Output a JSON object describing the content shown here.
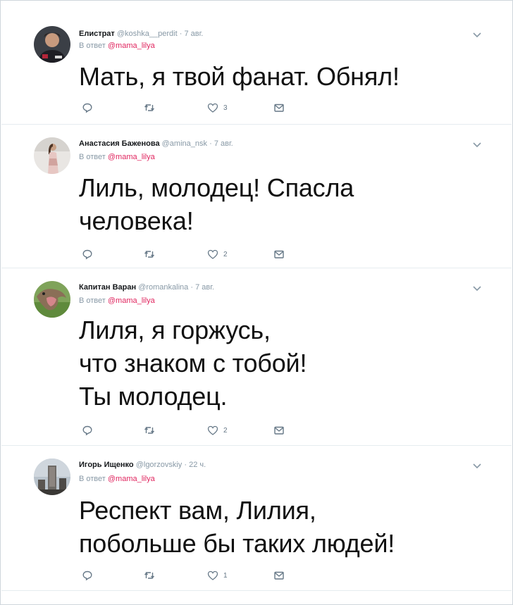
{
  "tweets": [
    {
      "name": "Елистрат",
      "handle": "@koshka__perdit",
      "time": "7 авг.",
      "reply_prefix": "В ответ",
      "reply_to": "@mama_lilya",
      "text": "Мать, я твой фанат. Обнял!",
      "likes": "3"
    },
    {
      "name": "Анастасия Баженова",
      "handle": "@amina_nsk",
      "time": "7 авг.",
      "reply_prefix": "В ответ",
      "reply_to": "@mama_lilya",
      "text": "Лиль, молодец! Спасла\nчеловека!",
      "likes": "2"
    },
    {
      "name": "Капитан Варан",
      "handle": "@romankalina",
      "time": "7 авг.",
      "reply_prefix": "В ответ",
      "reply_to": "@mama_lilya",
      "text": "Лиля, я горжусь,\nчто знаком с тобой!\nТы молодец.",
      "likes": "2"
    },
    {
      "name": "Игорь Ищенко",
      "handle": "@lgorzovskiy",
      "time": "22 ч.",
      "reply_prefix": "В ответ",
      "reply_to": "@mama_lilya",
      "text": "Респект вам, Лилия,\nпобольше бы таких людей!",
      "likes": "1"
    }
  ],
  "colors": {
    "mention": "#e0245e",
    "meta": "#8899a6",
    "icon": "#657786",
    "divider": "#e6ecf0"
  },
  "icons": [
    "reply-icon",
    "retweet-icon",
    "like-icon",
    "message-icon",
    "chevron-down-icon"
  ]
}
